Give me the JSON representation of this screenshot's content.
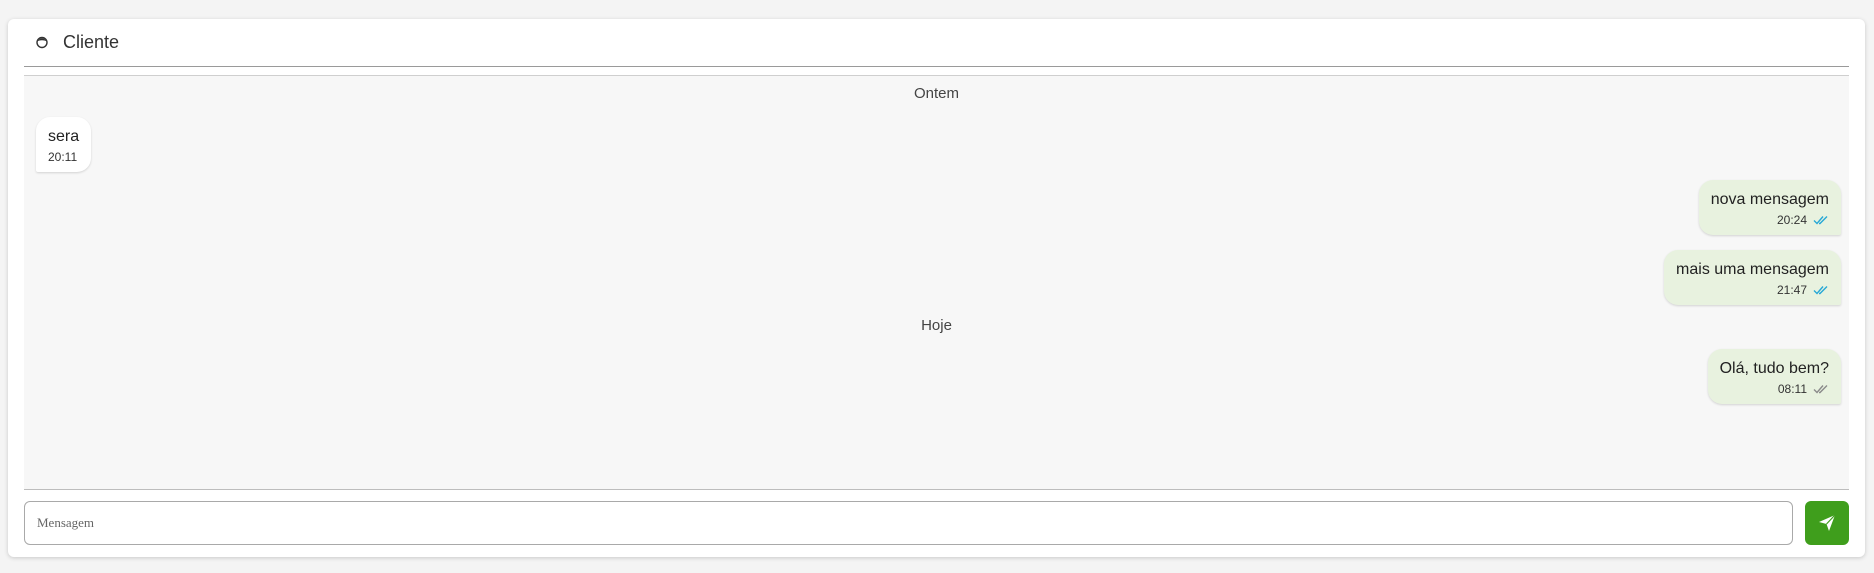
{
  "header": {
    "contact_name": "Cliente",
    "avatar_icon": "user-avatar-icon"
  },
  "conversation": {
    "separators": [
      "Ontem",
      "Hoje"
    ],
    "messages": [
      {
        "text": "sera",
        "time": "20:11",
        "direction": "in",
        "status": ""
      },
      {
        "text": "nova mensagem",
        "time": "20:24",
        "direction": "out",
        "status": "read"
      },
      {
        "text": "mais uma mensagem",
        "time": "21:47",
        "direction": "out",
        "status": "read"
      },
      {
        "text": "Olá, tudo bem?",
        "time": "08:11",
        "direction": "out",
        "status": "delivered"
      }
    ]
  },
  "composer": {
    "placeholder": "Mensagem",
    "value": "",
    "send_icon": "send-icon"
  },
  "colors": {
    "incoming_bubble": "#ffffff",
    "outgoing_bubble": "#e8f2df",
    "read_check": "#27a8d6",
    "delivered_check": "#8a8a8a",
    "send_button": "#3f9e1c",
    "chat_background": "#f7f7f7"
  }
}
